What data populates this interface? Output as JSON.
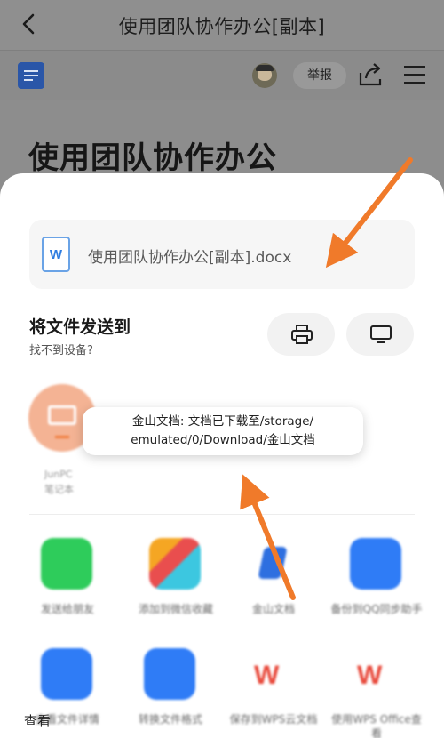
{
  "header": {
    "title": "使用团队协作办公[副本]"
  },
  "toolbar": {
    "report_label": "举报"
  },
  "document": {
    "heading": "使用团队协作办公"
  },
  "share_sheet": {
    "file_name": "使用团队协作办公[副本].docx",
    "file_icon_letter": "W",
    "send_to_title": "将文件发送到",
    "send_to_subtitle": "找不到设备?",
    "device": {
      "name_line1": "JunPC",
      "name_line2": "笔记本"
    },
    "apps_row1": [
      {
        "label": "发送给朋友",
        "icon": "wechat-icon",
        "color": "#2ecc5b"
      },
      {
        "label": "添加到微信收藏",
        "icon": "cube-icon",
        "color": "#f5a623"
      },
      {
        "label": "金山文档",
        "icon": "kdocs-icon",
        "color": "#2e6fe0"
      },
      {
        "label": "备份到QQ同步助手",
        "icon": "folder-plus-icon",
        "color": "#2f7cf6"
      }
    ],
    "apps_row2": [
      {
        "label": "查看文件详情",
        "icon": "file-detail-icon",
        "color": "#2f7cf6"
      },
      {
        "label": "转换文件格式",
        "icon": "convert-icon",
        "color": "#2f7cf6"
      },
      {
        "label": "保存到WPS云文档",
        "icon": "wps-icon",
        "color": "#e8483a"
      },
      {
        "label": "使用WPS Office查看",
        "icon": "wps-icon",
        "color": "#e8483a"
      }
    ]
  },
  "toast": {
    "line1": "金山文档: 文档已下载至/storage/",
    "line2": "emulated/0/Download/金山文档"
  },
  "bottom_label": "查看"
}
